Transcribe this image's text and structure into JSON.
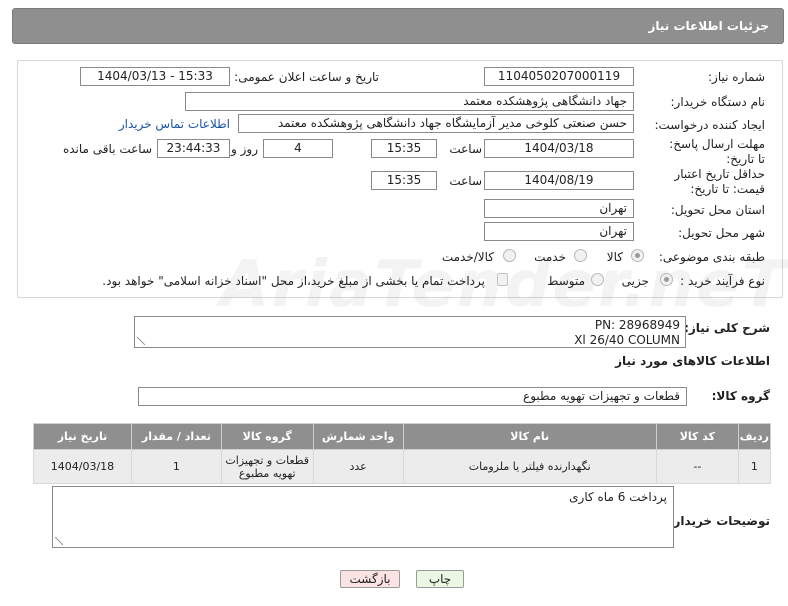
{
  "header": {
    "title": "جزئیات اطلاعات نیاز"
  },
  "form": {
    "need_number_label": "شماره نیاز:",
    "need_number": "1104050207000119",
    "announce_label": "تاریخ و ساعت اعلان عمومی:",
    "announce_value": "1404/03/13 - 15:33",
    "buyer_org_label": "نام دستگاه خریدار:",
    "buyer_org": "جهاد دانشگاهی پژوهشکده معتمد",
    "creator_label": "ایجاد کننده درخواست:",
    "creator": "حسن صنعتی کلوخی مدیر آزمایشگاه جهاد دانشگاهی پژوهشکده معتمد",
    "contact_link": "اطلاعات تماس خریدار",
    "deadline_label": "مهلت ارسال پاسخ: تا تاریخ:",
    "deadline_date": "1404/03/18",
    "time_label": "ساعت",
    "deadline_time": "15:35",
    "days_value": "4",
    "days_label": "روز و",
    "remaining_value": "23:44:33",
    "remaining_label": "ساعت باقی مانده",
    "validity_label": "حداقل تاریخ اعتبار قیمت: تا تاریخ:",
    "validity_date": "1404/08/19",
    "validity_time": "15:35",
    "province_label": "استان محل تحویل:",
    "province": "تهران",
    "city_label": "شهر محل تحویل:",
    "city": "تهران",
    "category_label": "طبقه بندی موضوعی:",
    "category_options": [
      "کالا",
      "خدمت",
      "کالا/خدمت"
    ],
    "process_label": "نوع فرآیند خرید :",
    "process_options": [
      "جزیی",
      "متوسط"
    ],
    "payment_note": "پرداخت تمام یا بخشی از مبلغ خرید،از محل \"اسناد خزانه اسلامی\" خواهد بود."
  },
  "description": {
    "label": "شرح کلی نیاز:",
    "line1": "PN: 28968949",
    "line2": "Xl 26/40 COLUMN"
  },
  "goods_info_title": "اطلاعات کالاهای مورد نیاز",
  "goods_group": {
    "label": "گروه کالا:",
    "value": "قطعات و تجهیزات تهویه مطبوع"
  },
  "table": {
    "headers": [
      "ردیف",
      "کد کالا",
      "نام کالا",
      "واحد شمارش",
      "گروه کالا",
      "تعداد / مقدار",
      "تاریخ نیاز"
    ],
    "rows": [
      [
        "1",
        "--",
        "نگهدارنده فیلتر یا ملزومات",
        "عدد",
        "قطعات و تجهیزات تهویه مطبوع",
        "1",
        "1404/03/18"
      ]
    ]
  },
  "buyer_notes": {
    "label": "توضیحات خریدار:",
    "value": "پرداخت 6 ماه کاری"
  },
  "buttons": {
    "print": "چاپ",
    "back": "بازگشت"
  },
  "watermark": "AriaTender.neT",
  "colors": {
    "header_bg": "#8f8f8f",
    "link": "#1a53a8",
    "print_btn": "#e9f7e3",
    "back_btn": "#fbe3e3"
  }
}
